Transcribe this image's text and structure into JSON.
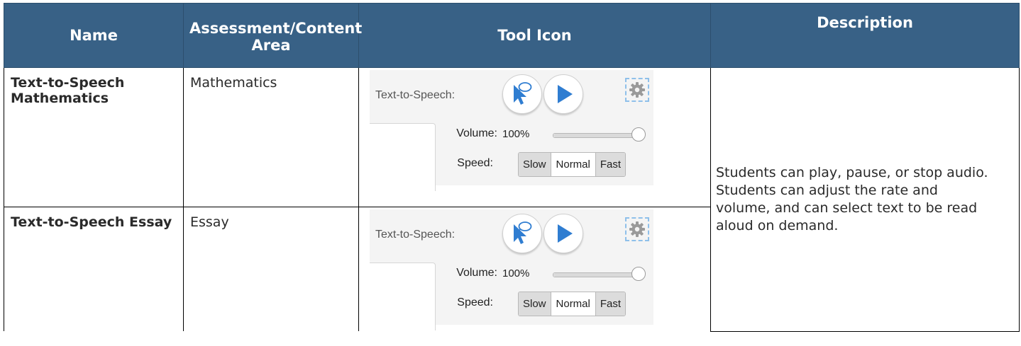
{
  "header": {
    "name": "Name",
    "area": "Assessment/Content Area",
    "icon": "Tool Icon",
    "description": "Description"
  },
  "rows": [
    {
      "name": "Text-to-Speech Mathematics",
      "area": "Mathematics",
      "widget": {
        "label": "Text-to-Speech:",
        "select_icon": "pointer-speech-bubble-icon",
        "play_icon": "play-icon",
        "settings_icon": "gear-icon",
        "volume_label": "Volume:",
        "volume_value": "100%",
        "volume_level": 1.0,
        "speed_label": "Speed:",
        "speeds": [
          "Slow",
          "Normal",
          "Fast"
        ],
        "selected_speed": "Normal"
      }
    },
    {
      "name": "Text-to-Speech Essay",
      "area": "Essay",
      "widget": {
        "label": "Text-to-Speech:",
        "select_icon": "pointer-speech-bubble-icon",
        "play_icon": "play-icon",
        "settings_icon": "gear-icon",
        "volume_label": "Volume:",
        "volume_value": "100%",
        "volume_level": 1.0,
        "speed_label": "Speed:",
        "speeds": [
          "Slow",
          "Normal",
          "Fast"
        ],
        "selected_speed": "Normal"
      }
    }
  ],
  "description": "Students can play, pause, or stop audio. Students can adjust the rate and volume, and can select text to be read aloud on demand.",
  "colors": {
    "header_bg": "#386186",
    "header_text": "#ffffff",
    "name_text": "#3d3522",
    "play_blue": "#2f7dd1",
    "gear_dash": "#8fc0ea"
  }
}
